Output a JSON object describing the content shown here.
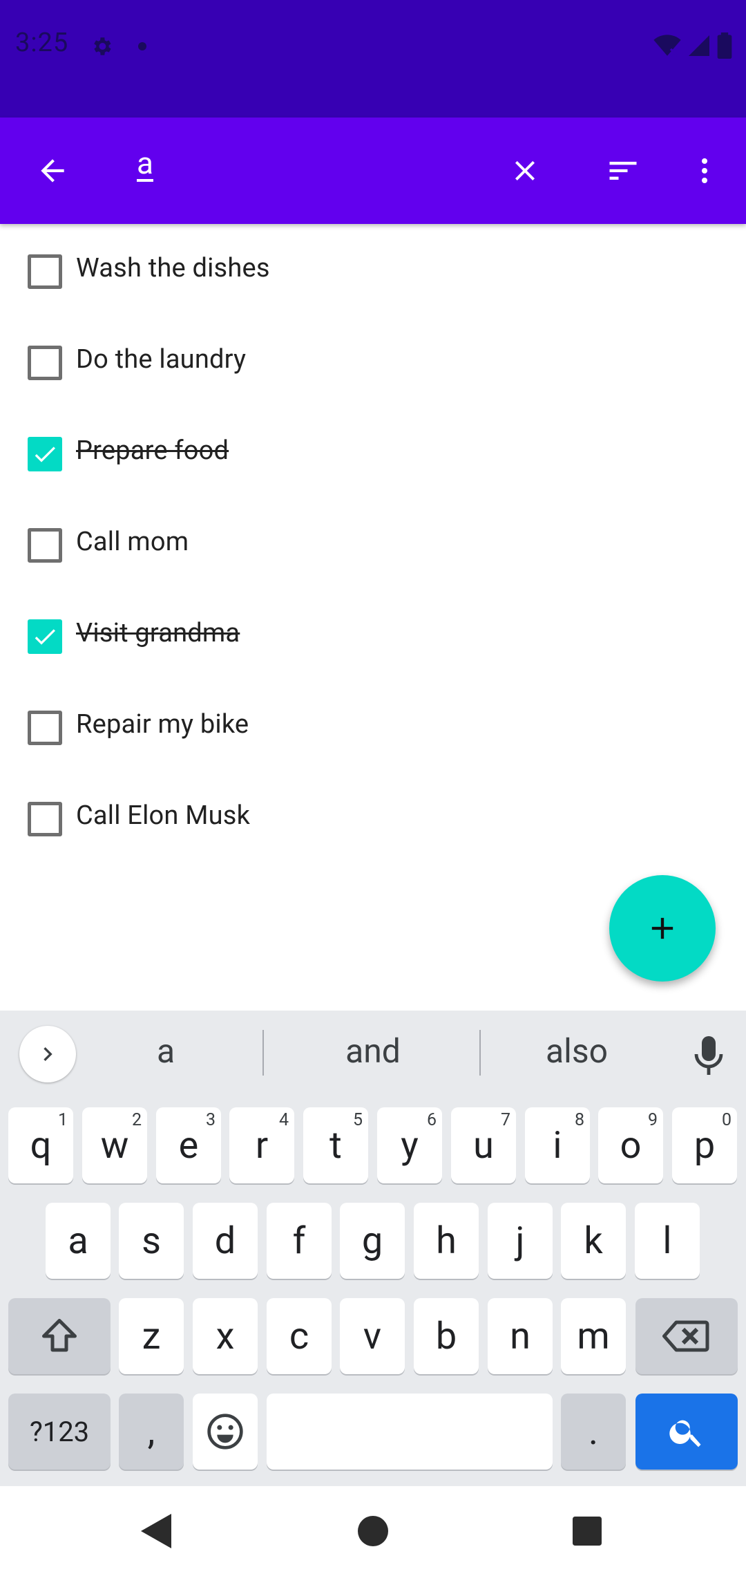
{
  "status_bar": {
    "time": "3:25"
  },
  "toolbar": {
    "search_query": "a"
  },
  "tasks": [
    {
      "label": "Wash the dishes",
      "done": false
    },
    {
      "label": "Do the laundry",
      "done": false
    },
    {
      "label": "Prepare food",
      "done": true
    },
    {
      "label": "Call mom",
      "done": false
    },
    {
      "label": "Visit grandma",
      "done": true
    },
    {
      "label": "Repair my bike",
      "done": false
    },
    {
      "label": "Call Elon Musk",
      "done": false
    }
  ],
  "keyboard": {
    "suggestions": [
      "a",
      "and",
      "also"
    ],
    "row1": [
      {
        "key": "q",
        "hint": "1"
      },
      {
        "key": "w",
        "hint": "2"
      },
      {
        "key": "e",
        "hint": "3"
      },
      {
        "key": "r",
        "hint": "4"
      },
      {
        "key": "t",
        "hint": "5"
      },
      {
        "key": "y",
        "hint": "6"
      },
      {
        "key": "u",
        "hint": "7"
      },
      {
        "key": "i",
        "hint": "8"
      },
      {
        "key": "o",
        "hint": "9"
      },
      {
        "key": "p",
        "hint": "0"
      }
    ],
    "row2": [
      "a",
      "s",
      "d",
      "f",
      "g",
      "h",
      "j",
      "k",
      "l"
    ],
    "row3": [
      "z",
      "x",
      "c",
      "v",
      "b",
      "n",
      "m"
    ],
    "symbols_label": "?123",
    "comma": ",",
    "period": "."
  },
  "colors": {
    "status_bar": "#3700b3",
    "toolbar": "#6200ee",
    "accent": "#03dac5",
    "search_key": "#1a73e8"
  }
}
